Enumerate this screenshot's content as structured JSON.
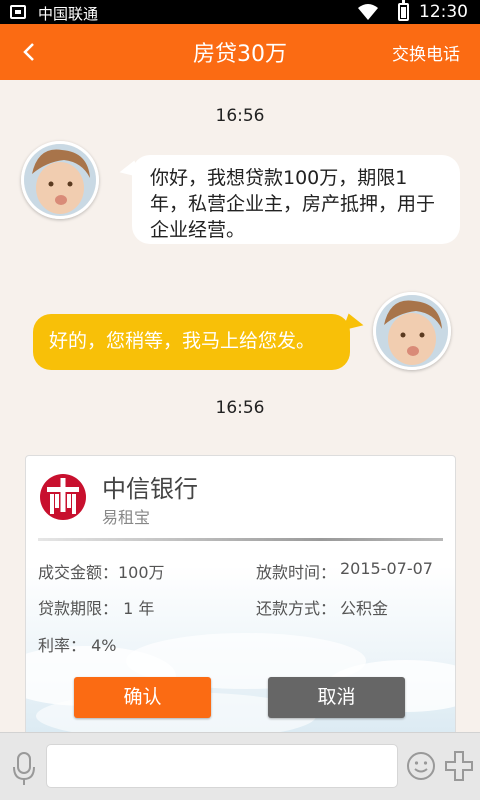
{
  "status_bar": {
    "carrier": "中国联通",
    "time": "12:30"
  },
  "header": {
    "title": "房贷30万",
    "switch_phone": "交换电话"
  },
  "chat": {
    "timestamp_1": "16:56",
    "incoming_message": "你好，我想贷款100万，期限1年，私营企业主，房产抵押，用于企业经营。",
    "outgoing_message": "好的，您稍等，我马上给您发。",
    "timestamp_2": "16:56"
  },
  "loan_card": {
    "bank_name": "中信银行",
    "product_name": "易租宝",
    "amount": "成交金额：100万",
    "release_time_label": "放款时间：",
    "release_time_value": "2015-07-07",
    "term": "贷款期限：  1  年",
    "repayment_label": "还款方式：",
    "repayment_value": "公积金",
    "rate": "利率：  4%",
    "confirm_label": "确认",
    "cancel_label": "取消",
    "brand_color": "#c8102e"
  },
  "input_bar": {
    "placeholder": "",
    "value": ""
  },
  "colors": {
    "accent": "#fb6b13",
    "outgoing_bubble": "#f8c008",
    "background": "#f7f1ec"
  }
}
